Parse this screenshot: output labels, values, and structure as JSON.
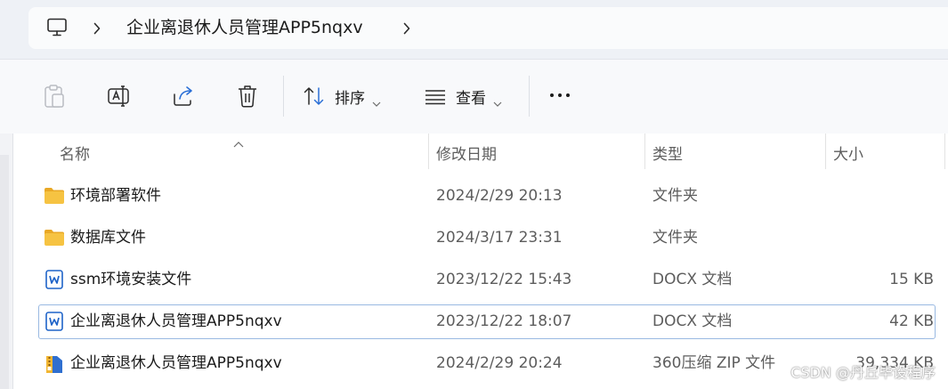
{
  "address": {
    "pc_icon": "computer-icon",
    "breadcrumb": "企业离退休人员管理APP5nqxv"
  },
  "toolbar": {
    "sort_label": "排序",
    "view_label": "查看",
    "icons": [
      "paste-icon",
      "rename-icon",
      "share-icon",
      "delete-icon",
      "sort-icon",
      "view-icon",
      "more-icon"
    ]
  },
  "columns": {
    "name": "名称",
    "date": "修改日期",
    "type": "类型",
    "size": "大小"
  },
  "files": [
    {
      "name": "环境部署软件",
      "date": "2024/2/29 20:13",
      "type": "文件夹",
      "size": "",
      "icon": "folder-icon"
    },
    {
      "name": "数据库文件",
      "date": "2024/3/17 23:31",
      "type": "文件夹",
      "size": "",
      "icon": "folder-icon"
    },
    {
      "name": "ssm环境安装文件",
      "date": "2023/12/22 15:43",
      "type": "DOCX 文档",
      "size": "15 KB",
      "icon": "docx-icon"
    },
    {
      "name": "企业离退休人员管理APP5nqxv",
      "date": "2023/12/22 18:07",
      "type": "DOCX 文档",
      "size": "42 KB",
      "icon": "docx-icon",
      "selected": true
    },
    {
      "name": "企业离退休人员管理APP5nqxv",
      "date": "2024/2/29 20:24",
      "type": "360压缩 ZIP 文件",
      "size": "39,334 KB",
      "icon": "zip-icon"
    }
  ],
  "watermark": "CSDN @丹丘毕设程序",
  "colors": {
    "folder": "#f6c342",
    "docx": "#1e63c8",
    "selection_border": "#99b9e2",
    "accent": "#2a6fd6"
  }
}
